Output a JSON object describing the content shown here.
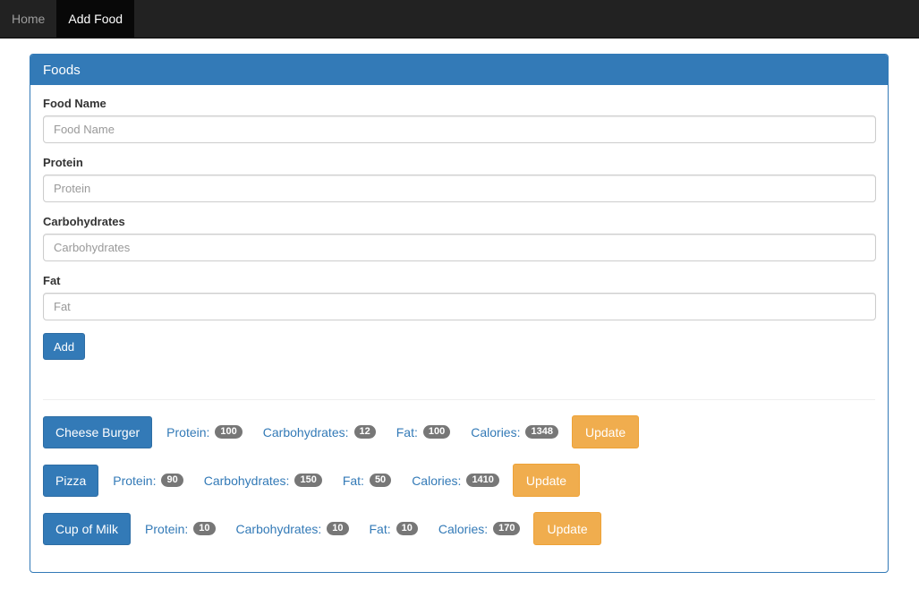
{
  "navbar": {
    "items": [
      {
        "label": "Home",
        "active": false
      },
      {
        "label": "Add Food",
        "active": true
      }
    ]
  },
  "panel": {
    "title": "Foods"
  },
  "form": {
    "fields": [
      {
        "label": "Food Name",
        "placeholder": "Food Name",
        "value": ""
      },
      {
        "label": "Protein",
        "placeholder": "Protein",
        "value": ""
      },
      {
        "label": "Carbohydrates",
        "placeholder": "Carbohydrates",
        "value": ""
      },
      {
        "label": "Fat",
        "placeholder": "Fat",
        "value": ""
      }
    ],
    "submit_label": "Add"
  },
  "stat_labels": {
    "protein": "Protein:",
    "carbohydrates": "Carbohydrates:",
    "fat": "Fat:",
    "calories": "Calories:"
  },
  "foods": [
    {
      "name": "Cheese Burger",
      "protein": "100",
      "carbohydrates": "12",
      "fat": "100",
      "calories": "1348",
      "update_label": "Update"
    },
    {
      "name": "Pizza",
      "protein": "90",
      "carbohydrates": "150",
      "fat": "50",
      "calories": "1410",
      "update_label": "Update"
    },
    {
      "name": "Cup of Milk",
      "protein": "10",
      "carbohydrates": "10",
      "fat": "10",
      "calories": "170",
      "update_label": "Update"
    }
  ],
  "colors": {
    "navbar": "#222222",
    "primary": "#337ab7",
    "warning": "#f0ad4e",
    "badge": "#777777"
  }
}
